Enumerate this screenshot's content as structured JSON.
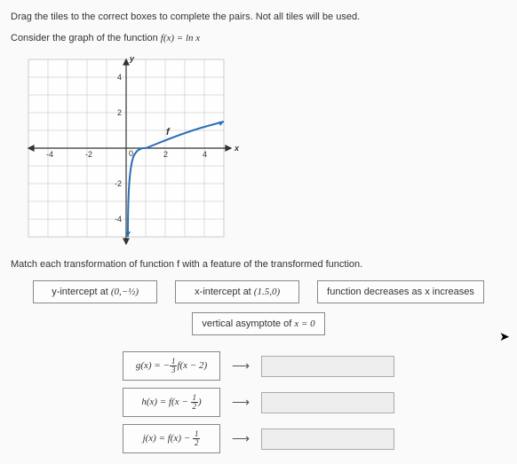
{
  "instructions": "Drag the tiles to the correct boxes to complete the pairs. Not all tiles will be used.",
  "consider": "Consider the graph of the function ",
  "func_expr": "f(x) = ln x",
  "axis_y": "y",
  "axis_x": "x",
  "curve_label": "f",
  "ticks": {
    "xn4": "-4",
    "xn2": "-2",
    "x0": "0",
    "x2": "2",
    "x4": "4",
    "y4": "4",
    "y2": "2",
    "yn2": "-2",
    "yn4": "-4"
  },
  "prompt2": "Match each transformation of function f with a feature of the transformed function.",
  "tiles": {
    "t1_pre": "y-intercept at ",
    "t1_pt": "(0,−½)",
    "t2_pre": "x-intercept at ",
    "t2_pt": "(1.5,0)",
    "t3": "function decreases as x increases",
    "t4_pre": "vertical asymptote of ",
    "t4_eq": "x = 0"
  },
  "rows": {
    "g_lhs": "g(x) = ",
    "g_rhs_a": "−",
    "g_rhs_b": "f(x − 2)",
    "h_lhs": "h(x) = ",
    "h_rhs_a": "f(x − ",
    "h_rhs_b": ")",
    "j_lhs": "j(x) = ",
    "j_rhs_a": "f(x) − "
  },
  "frac": {
    "one": "1",
    "two": "2",
    "three": "3"
  },
  "chart_data": {
    "type": "line",
    "title": "f(x) = ln x",
    "xlabel": "x",
    "ylabel": "y",
    "xlim": [
      -5,
      5
    ],
    "ylim": [
      -5,
      5
    ],
    "x": [
      0.1,
      0.2,
      0.4,
      0.6,
      0.8,
      1,
      1.5,
      2,
      2.5,
      3,
      3.5,
      4,
      4.5,
      5
    ],
    "values": [
      -2.3,
      -1.61,
      -0.92,
      -0.51,
      -0.22,
      0,
      0.41,
      0.69,
      0.92,
      1.1,
      1.25,
      1.39,
      1.5,
      1.61
    ]
  }
}
